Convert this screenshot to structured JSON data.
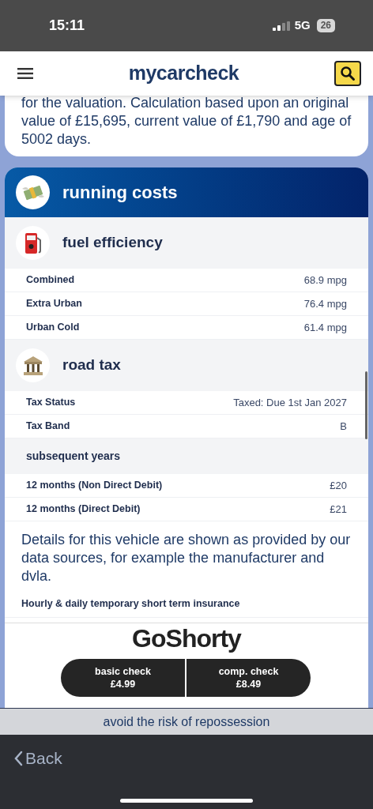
{
  "status_bar": {
    "time": "15:11",
    "network": "5G",
    "battery": "26"
  },
  "header": {
    "logo": "mycarcheck"
  },
  "valuation_note": "for the valuation. Calculation based upon an original value of £15,695, current value of £1,790 and age of 5002 days.",
  "running_costs": {
    "title": "running costs",
    "sections": [
      {
        "kind": "fuel",
        "title": "fuel efficiency",
        "rows": [
          {
            "label": "Combined",
            "value": "68.9 mpg"
          },
          {
            "label": "Extra Urban",
            "value": "76.4 mpg"
          },
          {
            "label": "Urban Cold",
            "value": "61.4 mpg"
          }
        ]
      },
      {
        "kind": "tax",
        "title": "road tax",
        "rows": [
          {
            "label": "Tax Status",
            "value": "Taxed: Due 1st Jan 2027"
          },
          {
            "label": "Tax Band",
            "value": "B"
          }
        ],
        "subheading": "subsequent years",
        "sub_rows": [
          {
            "label": "12 months (Non Direct Debit)",
            "value": "£20"
          },
          {
            "label": "12 months (Direct Debit)",
            "value": "£21"
          }
        ]
      }
    ],
    "disclaimer": "Details for this vehicle are shown as provided by our data sources, for example the manufacturer and dvla.",
    "insurance_heading": "Hourly & daily temporary short term insurance",
    "ad_logo": "GoShorty"
  },
  "check_buttons": [
    {
      "title": "basic check",
      "price": "£4.99"
    },
    {
      "title": "comp. check",
      "price": "£8.49"
    }
  ],
  "banner": "avoid the risk of repossession",
  "back": "Back"
}
